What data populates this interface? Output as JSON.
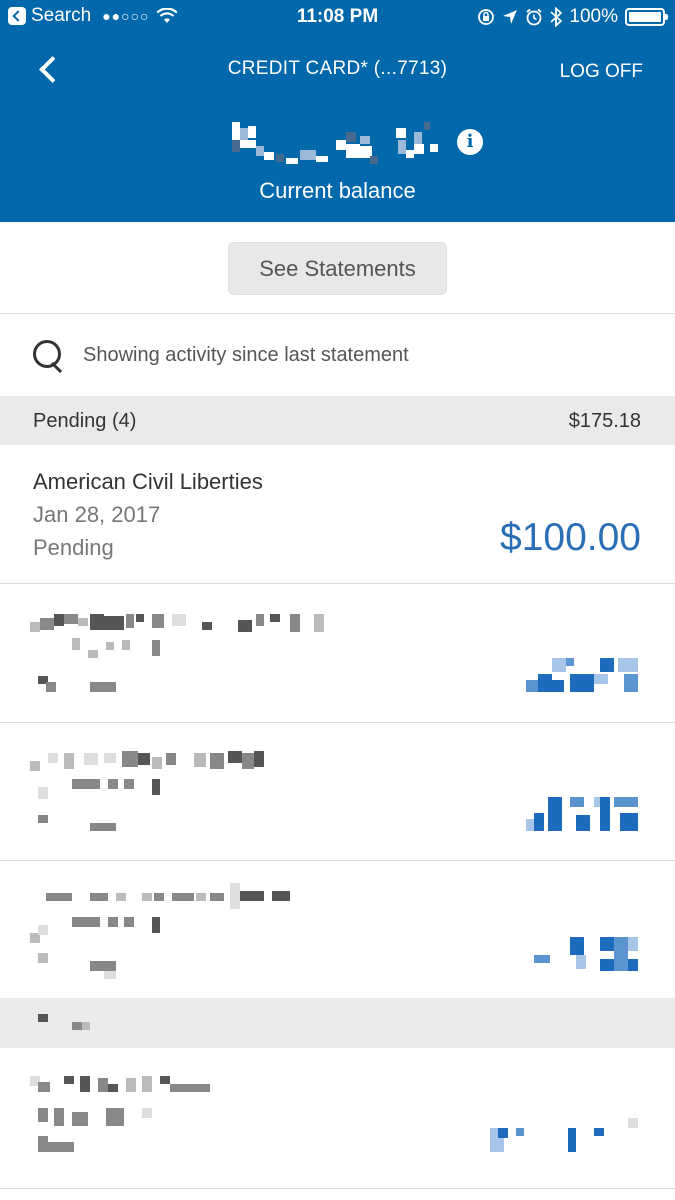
{
  "status_bar": {
    "back_label": "Search",
    "signal": "●●○○○",
    "time": "11:08 PM",
    "battery": "100%"
  },
  "header": {
    "title": "CREDIT CARD* (...7713)",
    "log_off": "LOG OFF",
    "balance_label": "Current balance"
  },
  "statements_button": "See Statements",
  "search": {
    "text": "Showing activity since last statement"
  },
  "pending": {
    "title": "Pending (4)",
    "total": "$175.18"
  },
  "transactions": [
    {
      "merchant": "American Civil Liberties",
      "date": "Jan 28, 2017",
      "status": "Pending",
      "amount": "$100.00"
    }
  ],
  "colors": {
    "brand_blue": "#0068ab",
    "amount_blue": "#2a6fb5",
    "section_gray": "#eaeaea"
  }
}
